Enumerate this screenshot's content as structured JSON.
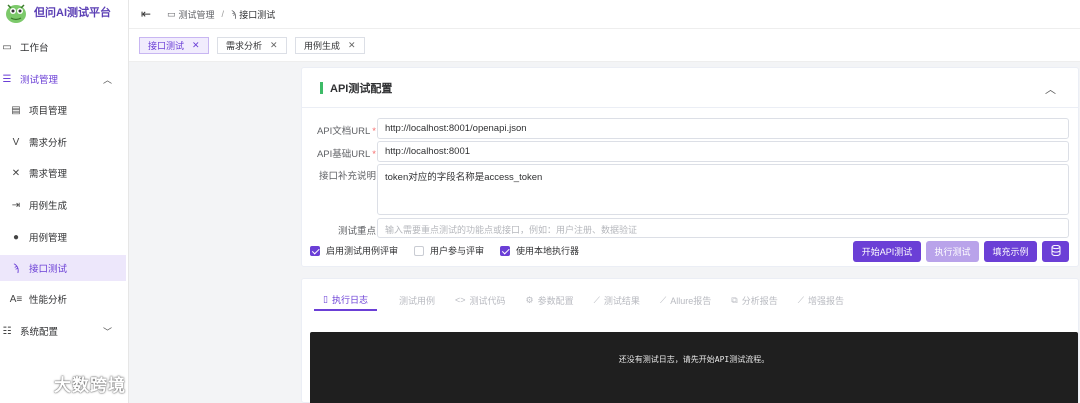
{
  "app": {
    "title": "但问AI测试平台"
  },
  "sidebar": {
    "items": [
      {
        "label": "工作台",
        "icon": "monitor-icon"
      },
      {
        "label": "测试管理",
        "icon": "list-icon"
      },
      {
        "label": "项目管理",
        "icon": "project-icon"
      },
      {
        "label": "需求分析",
        "icon": "analysis-icon"
      },
      {
        "label": "需求管理",
        "icon": "requirements-icon"
      },
      {
        "label": "用例生成",
        "icon": "generate-icon"
      },
      {
        "label": "用例管理",
        "icon": "pin-icon"
      },
      {
        "label": "接口测试",
        "icon": "api-icon"
      },
      {
        "label": "性能分析",
        "icon": "performance-icon"
      },
      {
        "label": "系统配置",
        "icon": "config-icon"
      }
    ]
  },
  "breadcrumb": {
    "parent": "测试管理",
    "current": "接口测试"
  },
  "tabs": [
    {
      "label": "接口测试"
    },
    {
      "label": "需求分析"
    },
    {
      "label": "用例生成"
    }
  ],
  "config": {
    "title": "API测试配置",
    "fields": {
      "doc_url": {
        "label": "API文档URL",
        "value": "http://localhost:8001/openapi.json"
      },
      "base_url": {
        "label": "API基础URL",
        "value": "http://localhost:8001"
      },
      "notes": {
        "label": "接口补充说明",
        "value": "token对应的字段名称是access_token"
      },
      "focus": {
        "label": "测试重点",
        "placeholder": "输入需要重点测试的功能点或接口，例如：用户注册、数据验证"
      }
    },
    "checkboxes": [
      {
        "label": "启用测试用例评审",
        "checked": true
      },
      {
        "label": "用户参与评审",
        "checked": false
      },
      {
        "label": "使用本地执行器",
        "checked": true
      }
    ],
    "buttons": {
      "start": "开始API测试",
      "execute": "执行测试",
      "fill": "填充示例"
    }
  },
  "result_tabs": [
    {
      "label": "执行日志"
    },
    {
      "label": "测试用例"
    },
    {
      "label": "测试代码"
    },
    {
      "label": "参数配置"
    },
    {
      "label": "测试结果"
    },
    {
      "label": "Allure报告"
    },
    {
      "label": "分析报告"
    },
    {
      "label": "增强报告"
    }
  ],
  "console": {
    "message": "还没有测试日志，请先开始API测试流程。"
  },
  "watermark": {
    "text": "大数跨境"
  },
  "colors": {
    "accent": "#6b3fd6",
    "accent_light": "#ede7fb",
    "title_bar": "#3dbb67",
    "console_bg": "#1f1f1f"
  }
}
